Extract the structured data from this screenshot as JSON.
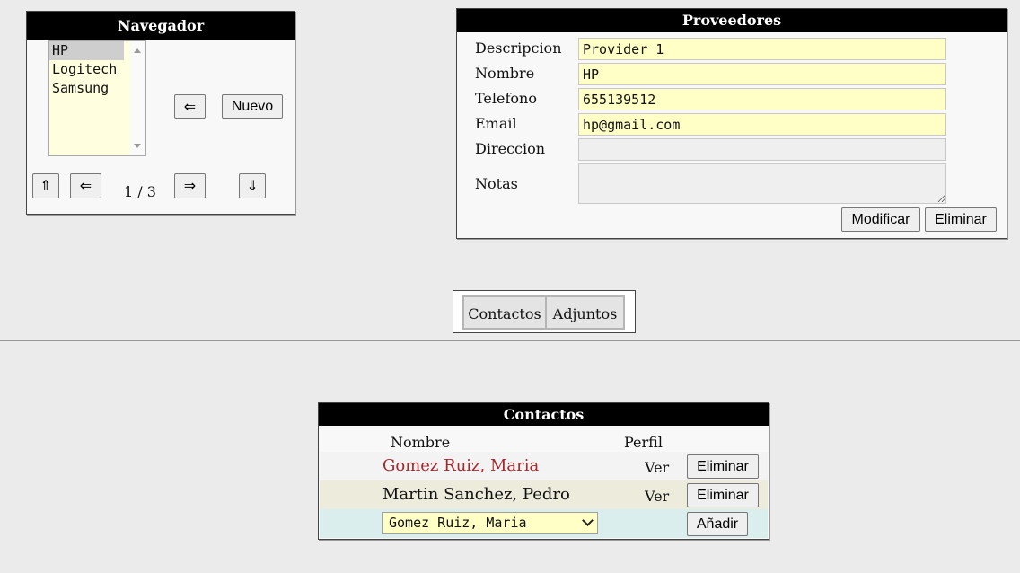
{
  "navigator": {
    "title": "Navegador",
    "items": [
      {
        "label": "HP",
        "selected": true
      },
      {
        "label": "Logitech",
        "selected": false
      },
      {
        "label": "Samsung",
        "selected": false
      }
    ],
    "back_arrow": "⇐",
    "new_label": "Nuevo",
    "first_arrow": "⇑",
    "prev_arrow": "⇐",
    "next_arrow": "⇒",
    "last_arrow": "⇓",
    "pager": "1 / 3"
  },
  "providers": {
    "title": "Proveedores",
    "fields": {
      "descripcion": {
        "label": "Descripcion",
        "value": "Provider 1"
      },
      "nombre": {
        "label": "Nombre",
        "value": "HP"
      },
      "telefono": {
        "label": "Telefono",
        "value": "655139512"
      },
      "email": {
        "label": "Email",
        "value": "hp@gmail.com"
      },
      "direccion": {
        "label": "Direccion",
        "value": ""
      },
      "notas": {
        "label": "Notas",
        "value": ""
      }
    },
    "modify_label": "Modificar",
    "delete_label": "Eliminar"
  },
  "tabs": [
    {
      "label": "Contactos"
    },
    {
      "label": "Adjuntos"
    }
  ],
  "contacts": {
    "title": "Contactos",
    "headers": {
      "name": "Nombre",
      "profile": "Perfil"
    },
    "rows": [
      {
        "name": "Gomez Ruiz, Maria",
        "view": "Ver",
        "delete": "Eliminar",
        "name_color": "#a4282d",
        "bg": "#f3f3f3"
      },
      {
        "name": "Martin Sanchez, Pedro",
        "view": "Ver",
        "delete": "Eliminar",
        "name_color": "#111111",
        "bg": "#ecebdc"
      }
    ],
    "add_row": {
      "selected": "Gomez Ruiz, Maria",
      "add_label": "Añadir",
      "bg": "#dbeeee"
    }
  }
}
